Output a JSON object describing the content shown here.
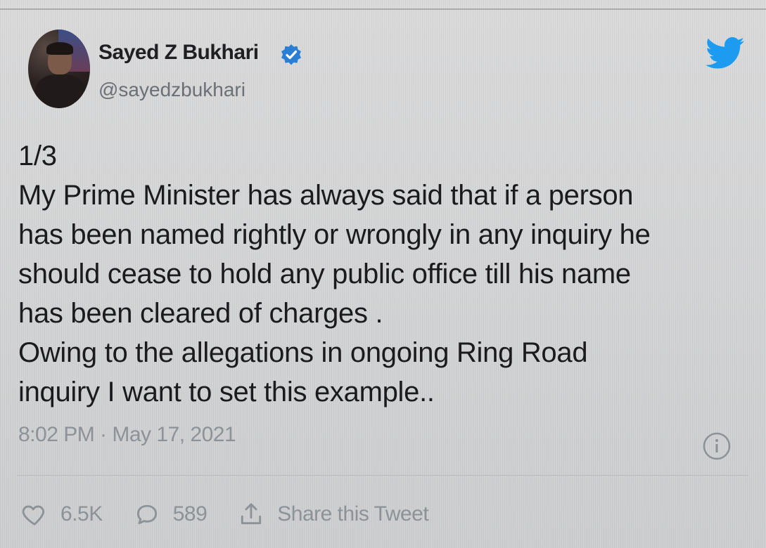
{
  "author": {
    "name": "Sayed Z Bukhari",
    "handle": "@sayedzbukhari",
    "verified_icon": "verified-badge-icon",
    "avatar_icon": "profile-photo"
  },
  "tweet": {
    "text": "1/3\nMy Prime Minister has always said that if a person\nhas been named rightly or wrongly in any inquiry he\nshould cease to hold any public office till his name\nhas been cleared of charges .\nOwing to the allegations in ongoing Ring Road\ninquiry I want to set this  example..",
    "timestamp": "8:02 PM · May 17, 2021"
  },
  "actions": {
    "likes": "6.5K",
    "replies": "589",
    "share_label": "Share this Tweet"
  },
  "icons": {
    "brand": "twitter-bird-icon",
    "info": "info-icon",
    "like": "heart-icon",
    "reply": "reply-bubble-icon",
    "share": "share-icon"
  },
  "colors": {
    "brand_blue": "#1d9bf0",
    "verified_blue": "#2a7fd4",
    "text": "#1b1b1d",
    "muted": "#8d9297"
  }
}
